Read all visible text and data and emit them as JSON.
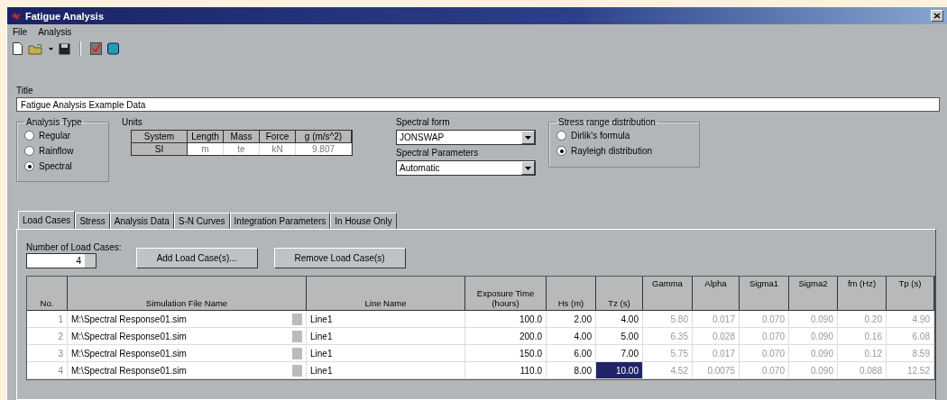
{
  "window": {
    "title": "Fatigue Analysis"
  },
  "menu": [
    "File",
    "Analysis"
  ],
  "title_field": {
    "label": "Title",
    "value": "Fatigue Analysis Example Data"
  },
  "analysis_type": {
    "label": "Analysis Type",
    "options": [
      {
        "label": "Regular",
        "selected": false
      },
      {
        "label": "Rainflow",
        "selected": false
      },
      {
        "label": "Spectral",
        "selected": true
      }
    ]
  },
  "units": {
    "label": "Units",
    "columns": [
      "System",
      "Length",
      "Mass",
      "Force",
      "g (m/s^2)"
    ],
    "values": [
      "SI",
      "m",
      "te",
      "kN",
      "9.807"
    ]
  },
  "spectral_form": {
    "label": "Spectral form",
    "value": "JONSWAP"
  },
  "spectral_parameters": {
    "label": "Spectral Parameters",
    "value": "Automatic"
  },
  "stress_range": {
    "label": "Stress range distribution",
    "options": [
      {
        "label": "Dirlik's formula",
        "selected": false
      },
      {
        "label": "Rayleigh distribution",
        "selected": true
      }
    ]
  },
  "tabs": [
    {
      "label": "Load Cases",
      "selected": true
    },
    {
      "label": "Stress",
      "selected": false
    },
    {
      "label": "Analysis Data",
      "selected": false
    },
    {
      "label": "S-N Curves",
      "selected": false
    },
    {
      "label": "Integration Parameters",
      "selected": false
    },
    {
      "label": "In House Only",
      "selected": false
    }
  ],
  "load_cases": {
    "label": "Number of Load Cases:",
    "value": "4"
  },
  "buttons": [
    "Add Load Case(s)...",
    "Remove Load Case(s)"
  ],
  "table": {
    "columns": [
      {
        "label": "No.",
        "kind": "index"
      },
      {
        "label": "Simulation File Name",
        "kind": "file"
      },
      {
        "label": "Line Name",
        "kind": "text"
      },
      {
        "label": "Exposure Time (hours)",
        "kind": "number",
        "computed": false
      },
      {
        "label": "Hs (m)",
        "kind": "number",
        "computed": false
      },
      {
        "label": "Tz (s)",
        "kind": "number",
        "computed": false
      },
      {
        "label": "Gamma",
        "kind": "number",
        "computed": true
      },
      {
        "label": "Alpha",
        "kind": "number",
        "computed": true
      },
      {
        "label": "Sigma1",
        "kind": "number",
        "computed": true
      },
      {
        "label": "Sigma2",
        "kind": "number",
        "computed": true
      },
      {
        "label": "fm (Hz)",
        "kind": "number",
        "computed": true
      },
      {
        "label": "Tp (s)",
        "kind": "number",
        "computed": true
      }
    ],
    "rows": [
      {
        "cells": [
          {
            "text": "1",
            "selected": false
          },
          {
            "text": "M:\\Spectral Response01.sim",
            "selected": false
          },
          {
            "text": "Line1",
            "selected": false
          },
          {
            "text": "100.0",
            "selected": false
          },
          {
            "text": "2.00",
            "selected": false
          },
          {
            "text": "4.00",
            "selected": false
          },
          {
            "text": "5.80",
            "selected": false
          },
          {
            "text": "0.017",
            "selected": false
          },
          {
            "text": "0.070",
            "selected": false
          },
          {
            "text": "0.090",
            "selected": false
          },
          {
            "text": "0.20",
            "selected": false
          },
          {
            "text": "4.90",
            "selected": false
          }
        ]
      },
      {
        "cells": [
          {
            "text": "2",
            "selected": false
          },
          {
            "text": "M:\\Spectral Response01.sim",
            "selected": false
          },
          {
            "text": "Line1",
            "selected": false
          },
          {
            "text": "200.0",
            "selected": false
          },
          {
            "text": "4.00",
            "selected": false
          },
          {
            "text": "5.00",
            "selected": false
          },
          {
            "text": "6.35",
            "selected": false
          },
          {
            "text": "0.028",
            "selected": false
          },
          {
            "text": "0.070",
            "selected": false
          },
          {
            "text": "0.090",
            "selected": false
          },
          {
            "text": "0.16",
            "selected": false
          },
          {
            "text": "6.08",
            "selected": false
          }
        ]
      },
      {
        "cells": [
          {
            "text": "3",
            "selected": false
          },
          {
            "text": "M:\\Spectral Response01.sim",
            "selected": false
          },
          {
            "text": "Line1",
            "selected": false
          },
          {
            "text": "150.0",
            "selected": false
          },
          {
            "text": "6.00",
            "selected": false
          },
          {
            "text": "7.00",
            "selected": false
          },
          {
            "text": "5.75",
            "selected": false
          },
          {
            "text": "0.017",
            "selected": false
          },
          {
            "text": "0.070",
            "selected": false
          },
          {
            "text": "0.090",
            "selected": false
          },
          {
            "text": "0.12",
            "selected": false
          },
          {
            "text": "8.59",
            "selected": false
          }
        ]
      },
      {
        "cells": [
          {
            "text": "4",
            "selected": false
          },
          {
            "text": "M:\\Spectral Response01.sim",
            "selected": false
          },
          {
            "text": "Line1",
            "selected": false
          },
          {
            "text": "110.0",
            "selected": false
          },
          {
            "text": "8.00",
            "selected": false
          },
          {
            "text": "10.00",
            "selected": true
          },
          {
            "text": "4.52",
            "selected": false
          },
          {
            "text": "0.0075",
            "selected": false
          },
          {
            "text": "0.070",
            "selected": false
          },
          {
            "text": "0.090",
            "selected": false
          },
          {
            "text": "0.088",
            "selected": false
          },
          {
            "text": "12.52",
            "selected": false
          }
        ]
      }
    ]
  }
}
